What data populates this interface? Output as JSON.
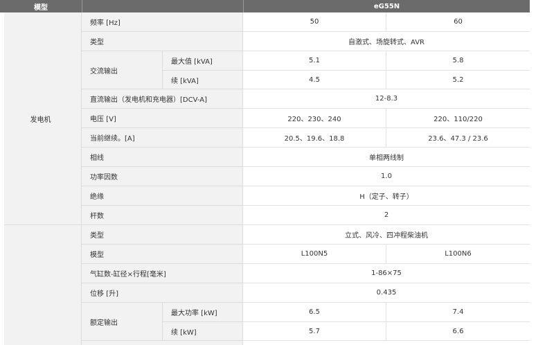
{
  "header": {
    "model_label": "模型",
    "product": "eG55N"
  },
  "generator": {
    "group_label": "发电机",
    "frequency": {
      "label": "频率 [Hz]",
      "v1": "50",
      "v2": "60"
    },
    "type": {
      "label": "类型",
      "value": "自激式、场旋转式、AVR"
    },
    "ac_output": {
      "label": "交流输出",
      "max": {
        "label": "最大值 [kVA]",
        "v1": "5.1",
        "v2": "5.8"
      },
      "cont": {
        "label": "续 [kVA]",
        "v1": "4.5",
        "v2": "5.2"
      }
    },
    "dc_output": {
      "label": "直流输出（发电机和充电器）[DCV-A]",
      "value": "12-8.3"
    },
    "voltage": {
      "label": "电压 [V]",
      "v1": "220、230、240",
      "v2": "220、110/220"
    },
    "current": {
      "label": "当前继续。[A]",
      "v1": "20.5、19.6、18.8",
      "v2": "23.6、47.3 / 23.6"
    },
    "phase": {
      "label": "相线",
      "value": "单相两线制"
    },
    "power_factor": {
      "label": "功率因数",
      "value": "1.0"
    },
    "insulation": {
      "label": "绝缘",
      "value": "H（定子、转子）"
    },
    "poles": {
      "label": "杆数",
      "value": "2"
    }
  },
  "engine": {
    "type": {
      "label": "类型",
      "value": "立式、风冷、四冲程柴油机"
    },
    "model": {
      "label": "模型",
      "v1": "L100N5",
      "v2": "L100N6"
    },
    "cylinders": {
      "label": "气缸数-缸径×行程[毫米]",
      "value": "1-86×75"
    },
    "displacement": {
      "label": "位移 [升]",
      "value": "0.435"
    },
    "rated_output": {
      "label": "额定输出",
      "max": {
        "label": "最大功率 [kW]",
        "v1": "6.5",
        "v2": "7.4"
      },
      "cont": {
        "label": "续 [kW]",
        "v1": "5.7",
        "v2": "6.6"
      }
    }
  }
}
